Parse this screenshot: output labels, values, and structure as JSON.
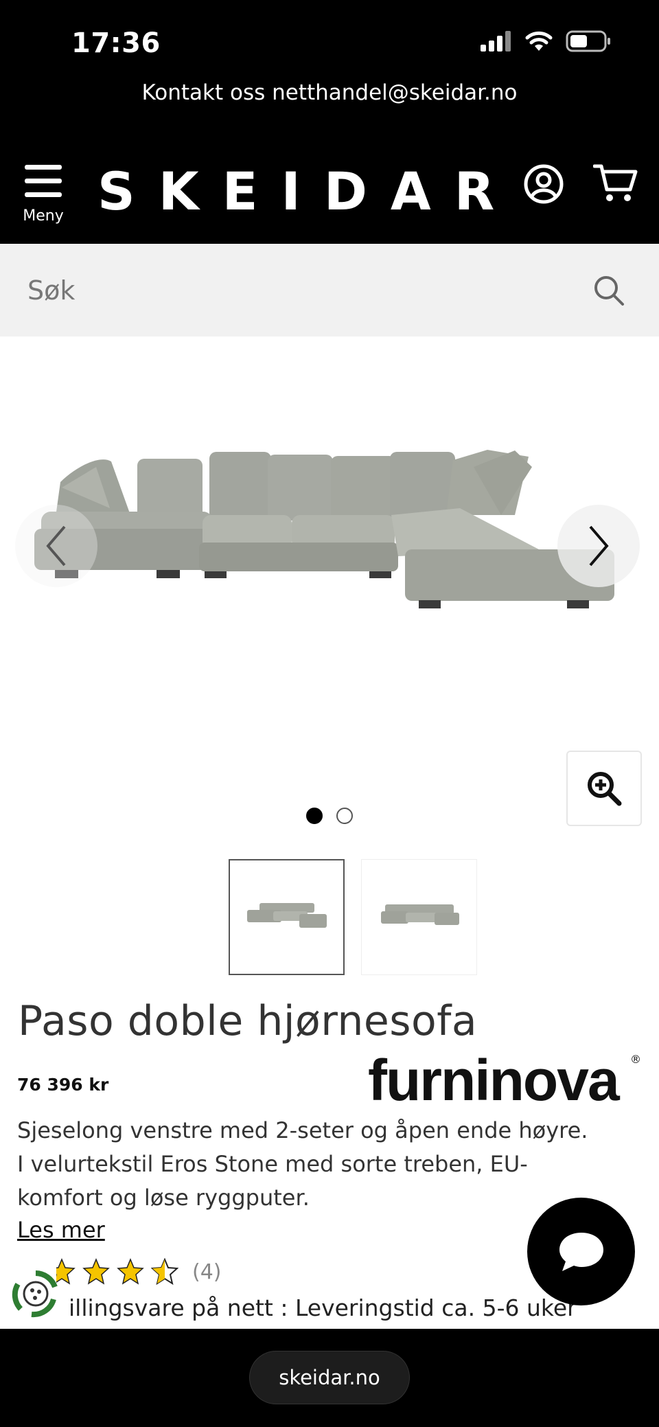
{
  "status_bar": {
    "time": "17:36"
  },
  "contact_bar": {
    "text": "Kontakt oss netthandel@skeidar.no"
  },
  "header": {
    "logo": "SKEIDAR",
    "menu_label": "Meny"
  },
  "search": {
    "placeholder": "Søk"
  },
  "gallery": {
    "slide_count": 2,
    "active_slide": 1
  },
  "product": {
    "title": "Paso doble hjørnesofa",
    "price": "76 396 kr",
    "brand": "furninova",
    "description_line1": "Sjeselong venstre med 2-seter og åpen ende høyre.",
    "description_line2": "I velurtekstil Eros Stone med sorte treben, EU-",
    "description_line3": "komfort og løse ryggputer.",
    "read_more": "Les mer",
    "rating": 3.5,
    "rating_count": "(4)",
    "delivery": "illingsvare på nett : Leveringstid ca. 5-6 uker"
  },
  "browser": {
    "url": "skeidar.no"
  },
  "colors": {
    "black": "#000000",
    "star": "#f5c400",
    "badge_green": "#2e7d32",
    "sofa": "#a2a59e"
  }
}
